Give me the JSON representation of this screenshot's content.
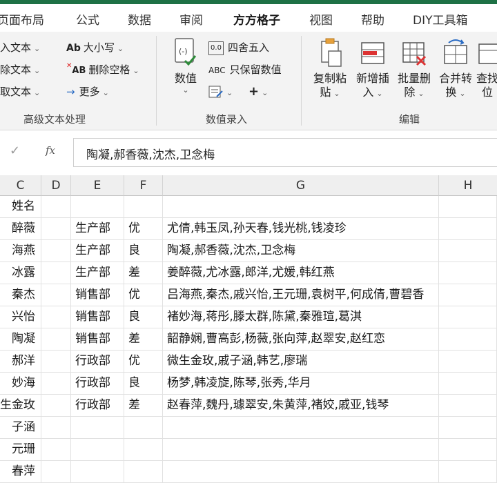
{
  "tabs": [
    {
      "label": "页面布局"
    },
    {
      "label": "公式"
    },
    {
      "label": "数据"
    },
    {
      "label": "审阅"
    },
    {
      "label": "方方格子",
      "active": true
    },
    {
      "label": "视图"
    },
    {
      "label": "帮助"
    },
    {
      "label": "DIY工具箱"
    }
  ],
  "ribbon": {
    "text_group": {
      "items_left": [
        "入文本",
        "除文本",
        "取文本"
      ],
      "items_right": [
        "大小写",
        "删除空格",
        "更多"
      ],
      "group_label": "高级文本处理"
    },
    "number_group": {
      "numeric_button": "数值",
      "round_label": "四舍五入",
      "keep_numeric_label": "只保留数值",
      "plus_symbol": "+",
      "group_label": "数值录入"
    },
    "edit_group": {
      "buttons": [
        {
          "line1": "复制粘",
          "line2": "贴"
        },
        {
          "line1": "新增插",
          "line2": "入"
        },
        {
          "line1": "批量删",
          "line2": "除"
        },
        {
          "line1": "合并转",
          "line2": "换"
        },
        {
          "line1": "查找",
          "line2": "位"
        }
      ],
      "group_label": "编辑"
    }
  },
  "formula_bar": {
    "fx_label": "fx",
    "value": "陶凝,郝香薇,沈杰,卫念梅"
  },
  "columns": [
    "C",
    "D",
    "E",
    "F",
    "G",
    "H"
  ],
  "col_c": [
    "姓名",
    "醉薇",
    "海燕",
    "冰露",
    "秦杰",
    "兴怡",
    "陶凝",
    "郝洋",
    "妙海",
    "生金玫",
    "子涵",
    "元珊",
    "春萍"
  ],
  "rows": [
    {
      "dept": "生产部",
      "grade": "优",
      "names": "尤倩,韩玉凤,孙天春,钱光桃,钱凌珍"
    },
    {
      "dept": "生产部",
      "grade": "良",
      "names": "陶凝,郝香薇,沈杰,卫念梅"
    },
    {
      "dept": "生产部",
      "grade": "差",
      "names": "姜醉薇,尤冰露,郎洋,尤媛,韩红燕"
    },
    {
      "dept": "销售部",
      "grade": "优",
      "names": "吕海燕,秦杰,戚兴怡,王元珊,袁树平,何成倩,曹碧香"
    },
    {
      "dept": "销售部",
      "grade": "良",
      "names": "褚妙海,蒋彤,滕太群,陈黛,秦雅瑄,葛淇"
    },
    {
      "dept": "销售部",
      "grade": "差",
      "names": "韶静娴,曹高彭,杨薇,张向萍,赵翠安,赵红恋"
    },
    {
      "dept": "行政部",
      "grade": "优",
      "names": "微生金玫,戚子涵,韩艺,廖瑞"
    },
    {
      "dept": "行政部",
      "grade": "良",
      "names": "杨梦,韩凌旋,陈琴,张秀,华月"
    },
    {
      "dept": "行政部",
      "grade": "差",
      "names": "赵春萍,魏丹,璩翠安,朱黄萍,褚姣,戚亚,钱琴"
    }
  ],
  "colors": {
    "accent": "#1e7145",
    "ribbon_bg": "#f3f3f3"
  }
}
